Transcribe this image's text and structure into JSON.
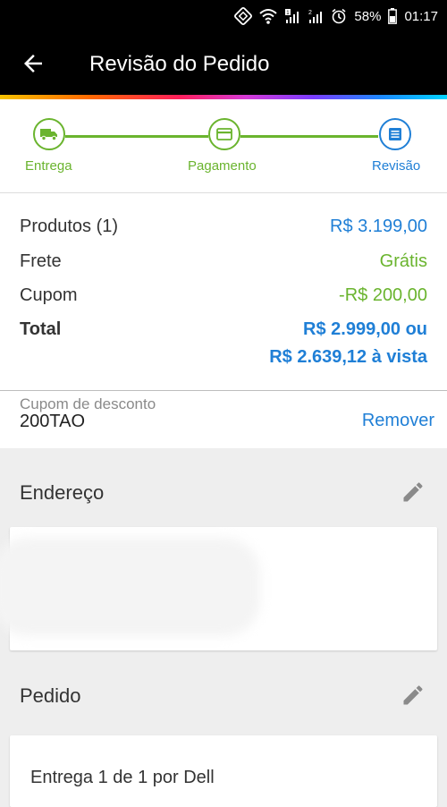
{
  "status_bar": {
    "battery": "58%",
    "time": "01:17",
    "icons": [
      "nfc-icon",
      "wifi-icon",
      "signal-icon",
      "signal-icon",
      "alarm-icon",
      "battery-icon"
    ]
  },
  "app_bar": {
    "title": "Revisão do Pedido",
    "back_icon": "arrow-left-icon"
  },
  "stepper": {
    "colors": {
      "done": "#6ab42e",
      "active": "#1f7fd6"
    },
    "steps": [
      {
        "label": "Entrega",
        "icon": "truck-icon",
        "state": "done"
      },
      {
        "label": "Pagamento",
        "icon": "card-icon",
        "state": "done"
      },
      {
        "label": "Revisão",
        "icon": "list-icon",
        "state": "active"
      }
    ]
  },
  "summary": {
    "products_label": "Produtos (1)",
    "products_value": "R$ 3.199,00",
    "shipping_label": "Frete",
    "shipping_value": "Grátis",
    "coupon_label": "Cupom",
    "coupon_value": "-R$ 200,00",
    "total_label": "Total",
    "total_value_line1": "R$ 2.999,00 ou",
    "total_value_line2": "R$ 2.639,12 à vista"
  },
  "discount": {
    "label": "Cupom de desconto",
    "code": "200TAO",
    "remove_label": "Remover"
  },
  "address_section": {
    "title": "Endereço",
    "edit_icon": "pencil-icon"
  },
  "order_section": {
    "title": "Pedido",
    "edit_icon": "pencil-icon",
    "delivery_text": "Entrega 1 de 1 por Dell"
  }
}
